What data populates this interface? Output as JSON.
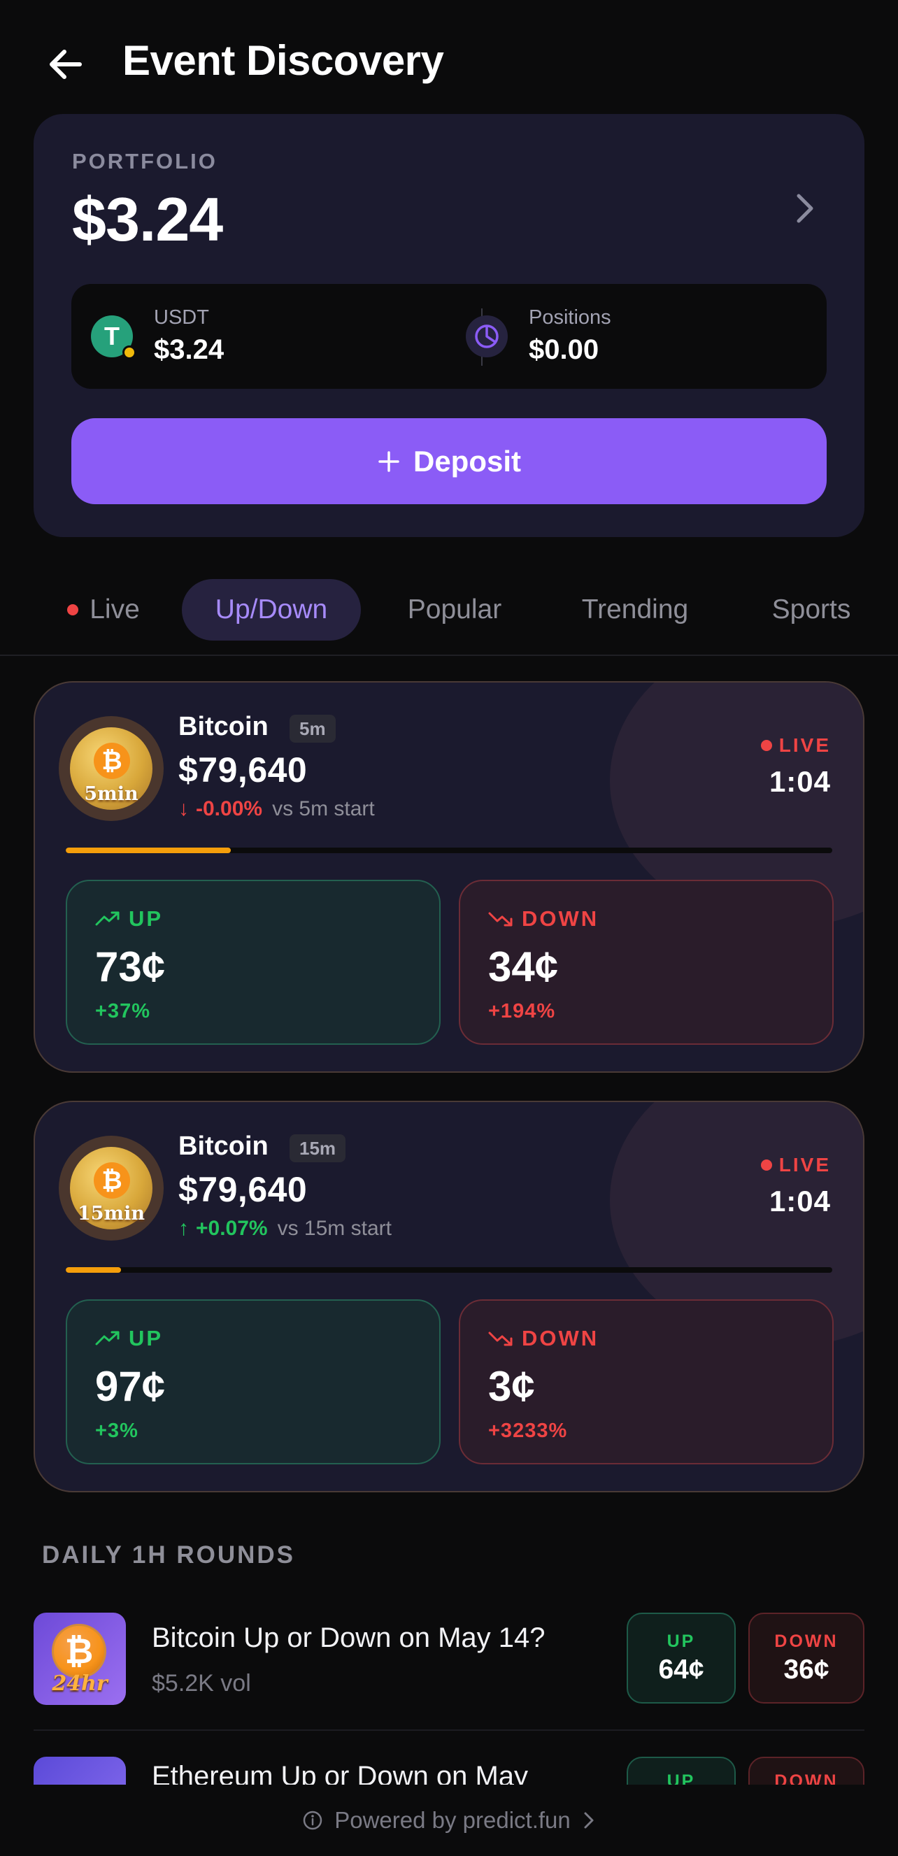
{
  "header": {
    "title": "Event Discovery",
    "back_icon": "arrow-left-icon"
  },
  "portfolio": {
    "label": "PORTFOLIO",
    "value": "$3.24",
    "usdt": {
      "label": "USDT",
      "value": "$3.24",
      "icon_glyph": "T"
    },
    "positions": {
      "label": "Positions",
      "value": "$0.00"
    },
    "deposit_label": "Deposit"
  },
  "tabs": [
    {
      "label": "Live",
      "active": false
    },
    {
      "label": "Up/Down",
      "active": true
    },
    {
      "label": "Popular",
      "active": false
    },
    {
      "label": "Trending",
      "active": false
    },
    {
      "label": "Sports",
      "active": false
    }
  ],
  "markets": [
    {
      "name": "Bitcoin",
      "timeframe": "5m",
      "coin_tag": "5min",
      "coin_glyph": "₿",
      "price": "$79,640",
      "change_arrow": "↓",
      "change_pct": "-0.00%",
      "change_vs": "vs 5m start",
      "change_dir": "down",
      "live_label": "LIVE",
      "timer": "1:04",
      "progress": 0.215,
      "up": {
        "label": "UP",
        "price": "73¢",
        "delta": "+37%"
      },
      "down": {
        "label": "DOWN",
        "price": "34¢",
        "delta": "+194%"
      }
    },
    {
      "name": "Bitcoin",
      "timeframe": "15m",
      "coin_tag": "15min",
      "coin_glyph": "₿",
      "price": "$79,640",
      "change_arrow": "↑",
      "change_pct": "+0.07%",
      "change_vs": "vs 15m start",
      "change_dir": "up",
      "live_label": "LIVE",
      "timer": "1:04",
      "progress": 0.072,
      "up": {
        "label": "UP",
        "price": "97¢",
        "delta": "+3%"
      },
      "down": {
        "label": "DOWN",
        "price": "3¢",
        "delta": "+3233%"
      }
    }
  ],
  "daily": {
    "title": "DAILY 1H ROUNDS",
    "rounds": [
      {
        "title": "Bitcoin Up or Down on May 14?",
        "volume": "$5.2K vol",
        "thumb_tag": "24hr",
        "thumb_glyph": "₿",
        "up_label": "UP",
        "up_price": "64¢",
        "down_label": "DOWN",
        "down_price": "36¢"
      },
      {
        "title": "Ethereum Up or Down on May",
        "volume": "",
        "thumb_tag": "",
        "thumb_glyph": "",
        "up_label": "UP",
        "up_price": "",
        "down_label": "DOWN",
        "down_price": ""
      }
    ]
  },
  "footer": {
    "text": "Powered by predict.fun"
  },
  "colors": {
    "accent": "#8b5cf6",
    "up": "#22c55e",
    "down": "#ef4444",
    "progress": "#f59e0b",
    "card": "#1b1a2e"
  }
}
